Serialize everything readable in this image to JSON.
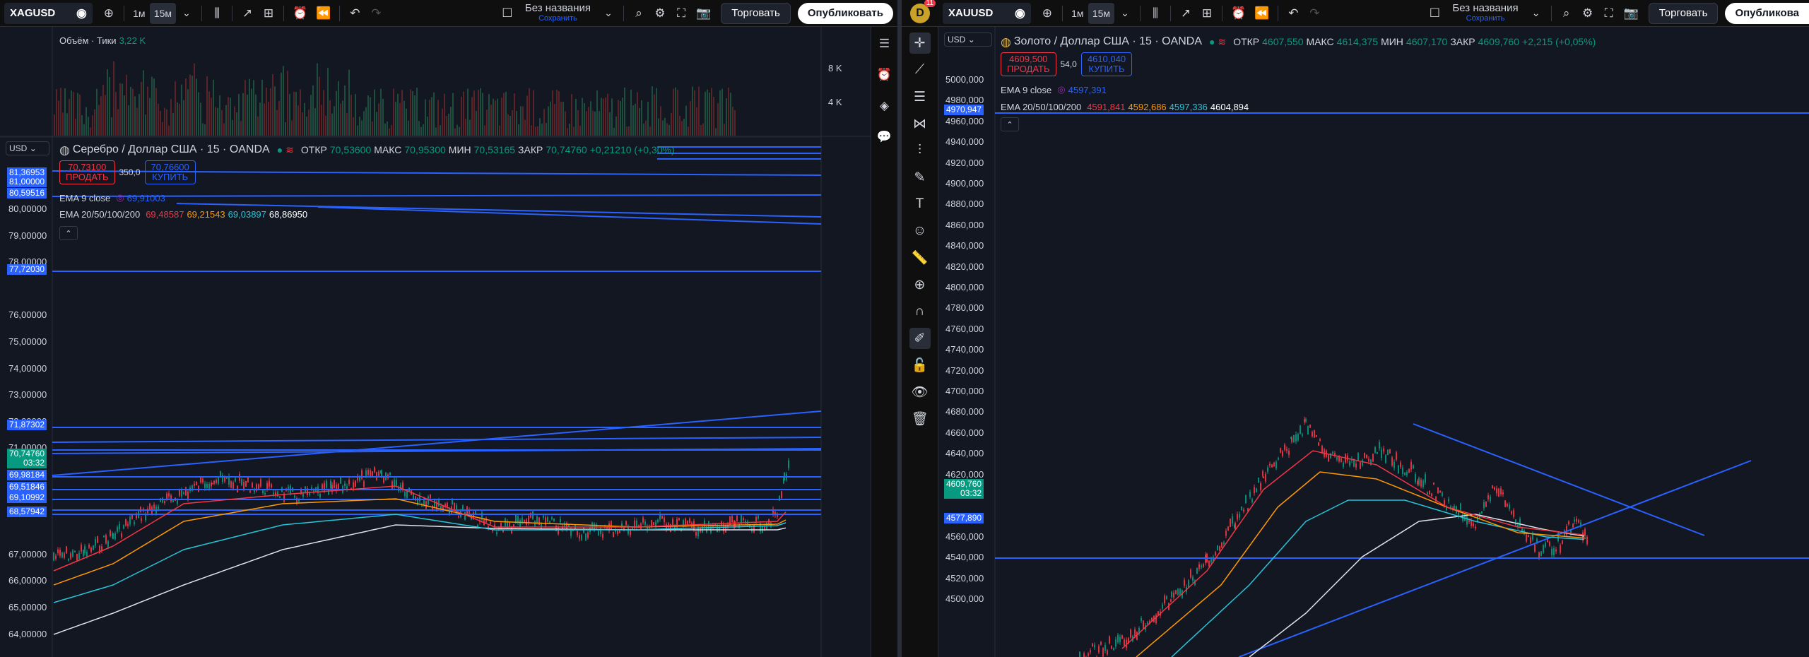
{
  "left": {
    "toolbar": {
      "symbol": "XAGUSD",
      "interval_1m": "1м",
      "interval_15m": "15м",
      "layout_name": "Без названия",
      "layout_save": "Сохранить",
      "trade": "Торговать",
      "publish": "Опубликовать"
    },
    "volume_legend": {
      "label": "Объём · Тики",
      "value": "3,22 K"
    },
    "volume_ticks": [
      "8 K",
      "4 K"
    ],
    "currency": "USD",
    "legend": {
      "title": "Серебро / Доллар США · 15 · OANDA",
      "open_label": "ОТКР",
      "open": "70,53600",
      "high_label": "МАКС",
      "high": "70,95300",
      "low_label": "МИН",
      "low": "70,53165",
      "close_label": "ЗАКР",
      "close": "70,74760",
      "change": "+0,21210 (+0,30%)"
    },
    "sell": {
      "price": "70,73100",
      "label": "ПРОДАТЬ"
    },
    "spread": "350,0",
    "buy": {
      "price": "70,76600",
      "label": "КУПИТЬ"
    },
    "ema9": {
      "label": "EMA 9 close",
      "value": "69,91003"
    },
    "ema_multi": {
      "label": "EMA 20/50/100/200",
      "v1": "69,48587",
      "v2": "69,21543",
      "v3": "69,03897",
      "v4": "68,86950"
    },
    "price_ticks": [
      "80,00000",
      "79,00000",
      "78,00000",
      "76,00000",
      "75,00000",
      "74,00000",
      "73,00000",
      "72,00000",
      "71,00000",
      "67,00000",
      "66,00000",
      "65,00000",
      "64,00000"
    ],
    "axis_tags": [
      "81,36953",
      "81,00000",
      "80,59516",
      "77,72030",
      "71,87302",
      "69,98184",
      "69,51846",
      "69,10992",
      "68,57942"
    ],
    "last_price": "70,74760",
    "countdown": "03:32"
  },
  "right": {
    "toolbar": {
      "avatar_letter": "D",
      "notifications": "11",
      "symbol": "XAUUSD",
      "interval_1m": "1м",
      "interval_15m": "15м",
      "layout_name": "Без названия",
      "layout_save": "Сохранить",
      "trade": "Торговать",
      "publish": "Опубликова"
    },
    "currency": "USD",
    "legend": {
      "title": "Золото / Доллар США · 15 · OANDA",
      "open_label": "ОТКР",
      "open": "4607,550",
      "high_label": "МАКС",
      "high": "4614,375",
      "low_label": "МИН",
      "low": "4607,170",
      "close_label": "ЗАКР",
      "close": "4609,760",
      "change": "+2,215 (+0,05%)"
    },
    "sell": {
      "price": "4609,500",
      "label": "ПРОДАТЬ"
    },
    "spread": "54,0",
    "buy": {
      "price": "4610,040",
      "label": "КУПИТЬ"
    },
    "ema9": {
      "label": "EMA 9 close",
      "value": "4597,391"
    },
    "ema_multi": {
      "label": "EMA 20/50/100/200",
      "v1": "4591,841",
      "v2": "4592,686",
      "v3": "4597,336",
      "v4": "4604,894"
    },
    "price_ticks": [
      "5000,000",
      "4980,000",
      "4960,000",
      "4940,000",
      "4920,000",
      "4900,000",
      "4880,000",
      "4860,000",
      "4840,000",
      "4820,000",
      "4800,000",
      "4780,000",
      "4760,000",
      "4740,000",
      "4720,000",
      "4700,000",
      "4680,000",
      "4660,000",
      "4640,000",
      "4620,000",
      "4560,000",
      "4540,000",
      "4520,000",
      "4500,000"
    ],
    "axis_tags": [
      "4970,947",
      "4577,890"
    ],
    "last_price": "4609,760",
    "countdown": "03:32"
  },
  "colors": {
    "accent": "#2962ff",
    "up": "#089981",
    "down": "#f23645",
    "bg": "#131722"
  }
}
